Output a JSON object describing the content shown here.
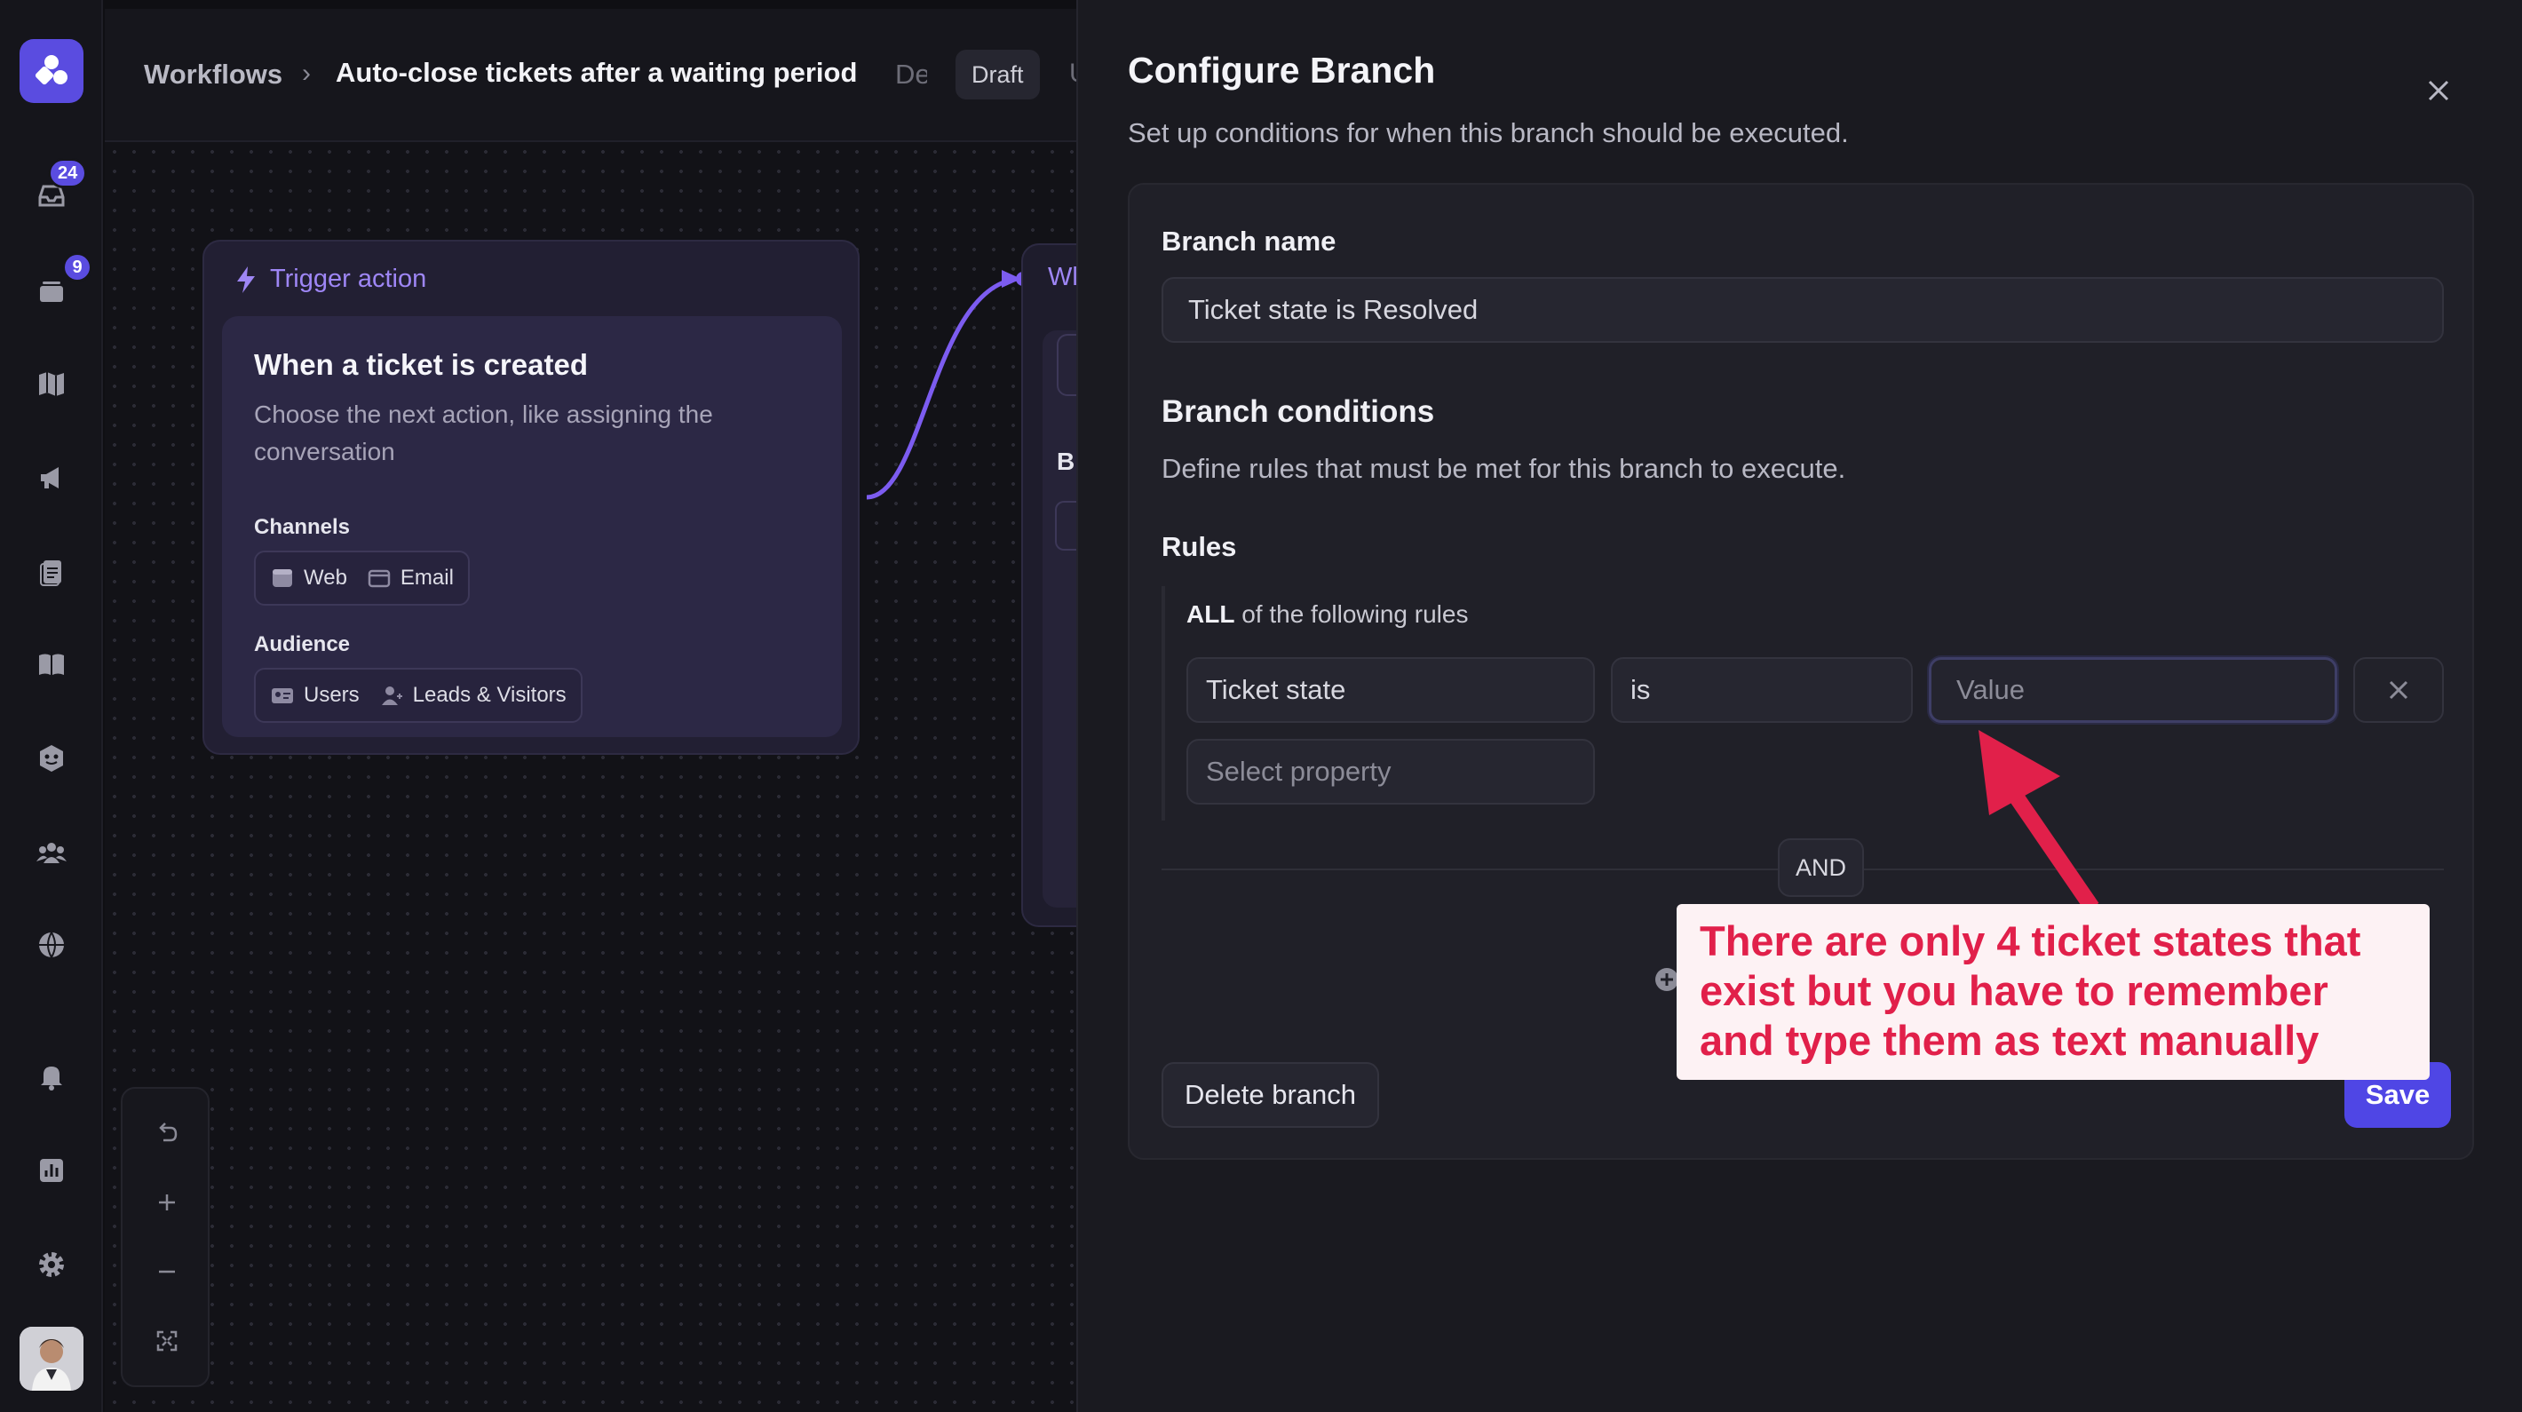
{
  "sidebar": {
    "badges": {
      "inbox": "24",
      "tickets": "9"
    },
    "icons": [
      "inbox-icon",
      "tickets-icon",
      "map-icon",
      "megaphone-icon",
      "reports-icon",
      "book-icon",
      "bot-icon",
      "people-icon",
      "globe-icon",
      "bell-icon",
      "chart-icon",
      "gear-icon"
    ]
  },
  "header": {
    "root": "Workflows",
    "separator": "›",
    "title": "Auto-close tickets after a waiting period",
    "desc_fragment": "De",
    "status": "Draft",
    "cut_fragment": "U"
  },
  "canvas": {
    "trigger": {
      "header": "Trigger action",
      "title": "When a ticket is created",
      "description": "Choose the next action, like assigning the conversation",
      "channels_label": "Channels",
      "channels": [
        "Web",
        "Email"
      ],
      "audience_label": "Audience",
      "audience": [
        "Users",
        "Leads & Visitors"
      ]
    },
    "next_node": {
      "header": "Wl",
      "section": "Br"
    }
  },
  "drawer": {
    "title": "Configure Branch",
    "subtitle": "Set up conditions for when this branch should be executed.",
    "branch_name_label": "Branch name",
    "branch_name_value": "Ticket state is Resolved",
    "conditions_title": "Branch conditions",
    "conditions_desc": "Define rules that must be met for this branch to execute.",
    "rules_label": "Rules",
    "rules_mode_strong": "ALL",
    "rules_mode_rest": " of the following rules",
    "rule": {
      "property": "Ticket state",
      "operator": "is",
      "value_placeholder": "Value"
    },
    "select_property_placeholder": "Select property",
    "and_label": "AND",
    "delete_label": "Delete branch",
    "save_label": "Save"
  },
  "annotation": {
    "text": "There are only 4 ticket states that exist but you have to remember and type them as text manually",
    "color": "#e1204a"
  },
  "colors": {
    "accent": "#5a4ce0",
    "save": "#4f46e5",
    "trigger": "#9e86f5"
  }
}
